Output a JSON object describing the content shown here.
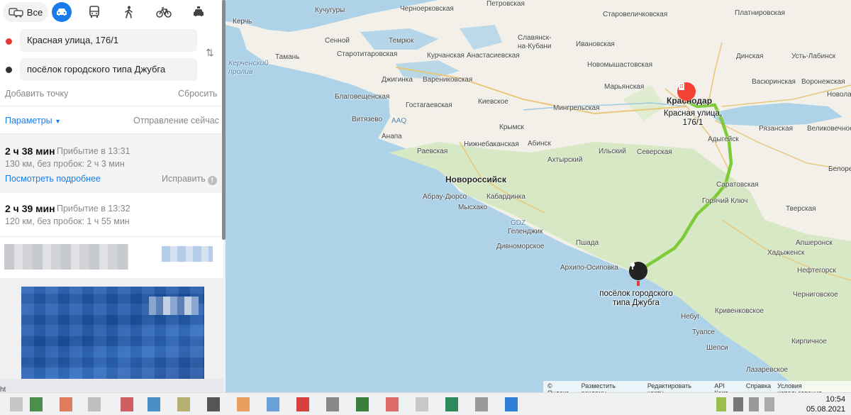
{
  "transport_modes": {
    "all_label": "Все",
    "items": [
      "car-icon",
      "bus-icon",
      "walk-icon",
      "bike-icon",
      "taxi-icon"
    ]
  },
  "route": {
    "from": "Красная улица, 176/1",
    "to": "посёлок городского типа Джубга",
    "add_point": "Добавить точку",
    "reset": "Сбросить",
    "params": "Параметры",
    "departure": "Отправление сейчас",
    "from_color": "#e53935",
    "to_color": "#333333"
  },
  "routes": [
    {
      "time": "2 ч 38 мин",
      "arrival": "Прибытие в 13:31",
      "distance": "130 км, без пробок: 2 ч 3 мин",
      "details": "Посмотреть подробнее",
      "fix": "Исправить"
    },
    {
      "time": "2 ч 39 мин",
      "arrival": "Прибытие в 13:32",
      "distance": "120 км, без пробок: 1 ч 55 мин"
    }
  ],
  "map": {
    "places": [
      {
        "name": "Керчь"
      },
      {
        "name": "Кучугуры"
      },
      {
        "name": "Черноерковская"
      },
      {
        "name": "Петровская"
      },
      {
        "name": "Старовеличковская"
      },
      {
        "name": "Платнировская"
      },
      {
        "name": "Сенной"
      },
      {
        "name": "Темрюк"
      },
      {
        "name": "Славянск-на-Кубани"
      },
      {
        "name": "Ивановская"
      },
      {
        "name": "Динская"
      },
      {
        "name": "Усть-Лабинск"
      },
      {
        "name": "Тамань"
      },
      {
        "name": "Старотитаровская"
      },
      {
        "name": "Курчанская"
      },
      {
        "name": "Анастасиевская"
      },
      {
        "name": "Новомышастовская"
      },
      {
        "name": "Керченский пролив"
      },
      {
        "name": "Джигинка"
      },
      {
        "name": "Варениковская"
      },
      {
        "name": "Марьянская"
      },
      {
        "name": "Васюринская"
      },
      {
        "name": "Воронежская"
      },
      {
        "name": "Благовещенская"
      },
      {
        "name": "Гостагаевская"
      },
      {
        "name": "Киевское"
      },
      {
        "name": "Мингрельская"
      },
      {
        "name": "Краснодар"
      },
      {
        "name": "Новолабинская"
      },
      {
        "name": "Витязево"
      },
      {
        "name": "AAQ"
      },
      {
        "name": "Крымск"
      },
      {
        "name": "Рязанская"
      },
      {
        "name": "Великовечное"
      },
      {
        "name": "Анапа"
      },
      {
        "name": "Нижнебаканская"
      },
      {
        "name": "Абинск"
      },
      {
        "name": "Адыгейск"
      },
      {
        "name": "Раевская"
      },
      {
        "name": "Ильский"
      },
      {
        "name": "Северская"
      },
      {
        "name": "Ахтырский"
      },
      {
        "name": "Белореченская"
      },
      {
        "name": "Новороссийск"
      },
      {
        "name": "Саратовская"
      },
      {
        "name": "Абрау-Дюрсо"
      },
      {
        "name": "Кабардинка"
      },
      {
        "name": "Горячий Ключ"
      },
      {
        "name": "Мысхако"
      },
      {
        "name": "Тверская"
      },
      {
        "name": "GDZ"
      },
      {
        "name": "Геленджик"
      },
      {
        "name": "Дивноморское"
      },
      {
        "name": "Пшада"
      },
      {
        "name": "Апшеронск"
      },
      {
        "name": "Хадыженск"
      },
      {
        "name": "Архипо-Осиповка"
      },
      {
        "name": "Нефтегорск"
      },
      {
        "name": "Небуг"
      },
      {
        "name": "Кривенковское"
      },
      {
        "name": "Черниговское"
      },
      {
        "name": "Туапсе"
      },
      {
        "name": "Шепси"
      },
      {
        "name": "Кирпичное"
      },
      {
        "name": "Лазаревское"
      }
    ],
    "start_label": "Красная улица, 176/1",
    "end_label": "посёлок городского типа Джубга",
    "footer": [
      "© Яндекс",
      "Разместить рекламу",
      "Редактировать карту",
      "API Карт",
      "Справка",
      "Условия использования"
    ],
    "route_color": "#7ecb3a",
    "start_pin_color": "#f44336",
    "end_pin_color": "#222222"
  },
  "taskbar": {
    "time": "10:54",
    "date": "05.08.2021",
    "left_text": "ht"
  }
}
